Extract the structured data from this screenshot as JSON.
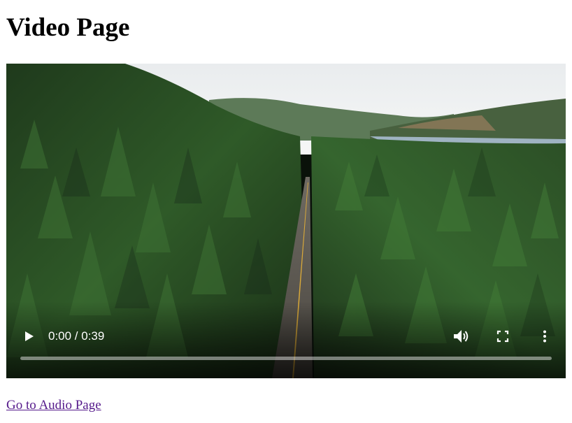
{
  "page": {
    "title": "Video Page"
  },
  "video": {
    "current_time": "0:00",
    "duration": "0:39",
    "time_display": "0:00 / 0:39",
    "progress": 0,
    "buffered": 1.0,
    "controls": {
      "play_icon": "play-icon",
      "volume_icon": "volume-icon",
      "fullscreen_icon": "fullscreen-icon",
      "more_icon": "more-vertical-icon"
    }
  },
  "link": {
    "label": "Go to Audio Page"
  },
  "colors": {
    "link_visited": "#551a8b",
    "control_fg": "#ffffff"
  }
}
